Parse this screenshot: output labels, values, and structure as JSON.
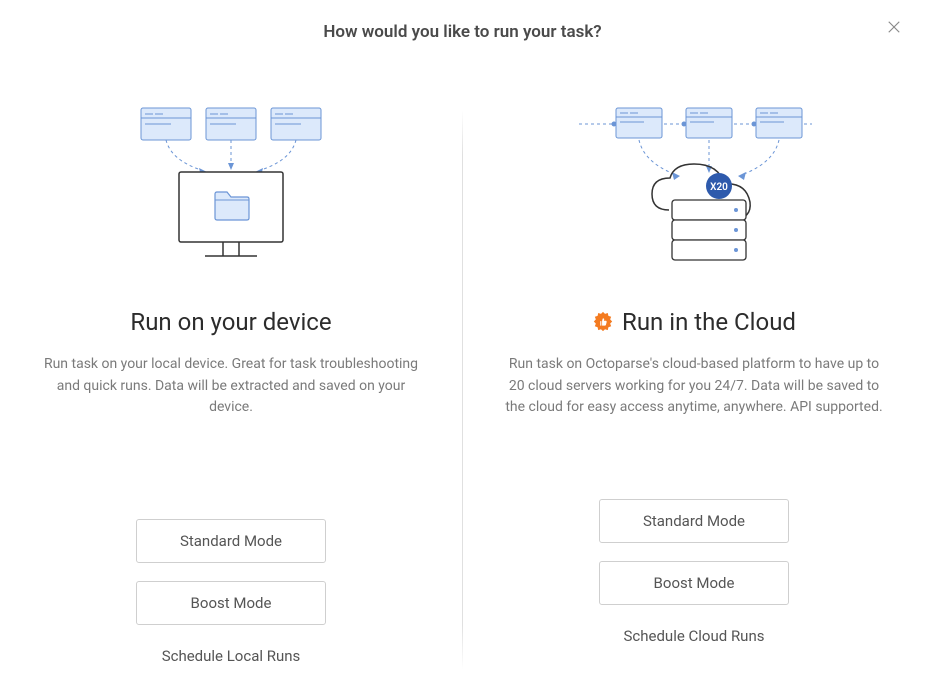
{
  "header": {
    "title": "How would you like to run your task?"
  },
  "left": {
    "title": "Run on your device",
    "description": "Run task on your local device. Great for task troubleshooting and quick runs. Data will be extracted and saved on your device.",
    "standard_label": "Standard Mode",
    "boost_label": "Boost Mode",
    "schedule_label": "Schedule Local Runs"
  },
  "right": {
    "title": "Run in the Cloud",
    "badge_text": "X20",
    "description": "Run task on Octoparse's cloud-based platform to have up to 20 cloud servers working for you 24/7. Data will be saved to the cloud for easy access anytime, anywhere. API supported.",
    "standard_label": "Standard Mode",
    "boost_label": "Boost Mode",
    "schedule_label": "Schedule Cloud Runs"
  }
}
